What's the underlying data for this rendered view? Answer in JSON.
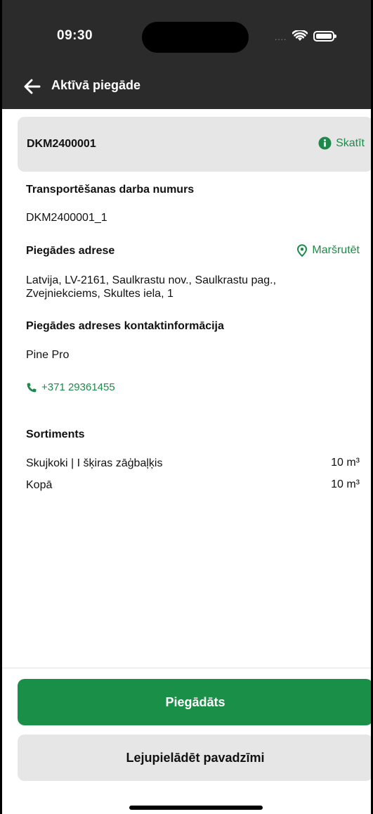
{
  "status_bar": {
    "time": "09:30",
    "signal": "....",
    "icons": [
      "wifi-icon",
      "battery-icon"
    ]
  },
  "nav": {
    "title": "Aktīvā piegāde",
    "back_icon": "arrow-left-icon"
  },
  "summary_card": {
    "id": "DKM2400001",
    "view_label": "Skatīt",
    "view_icon": "info-icon"
  },
  "details": {
    "job_number_label": "Transportēšanas darba numurs",
    "job_number_value": "DKM2400001_1",
    "address_label": "Piegādes adrese",
    "route_label": "Maršrutēt",
    "route_icon": "location-pin-icon",
    "address_line1": "Latvija, LV-2161, Saulkrastu nov., Saulkrastu pag.,",
    "address_line2": "Zvejniekciems, Skultes iela, 1",
    "contact_label": "Piegādes adreses kontaktinformācija",
    "contact_name": "Pine Pro",
    "phone": "+371 29361455",
    "phone_icon": "phone-icon"
  },
  "assortment": {
    "title": "Sortiments",
    "rows": [
      {
        "name": "Skujkoki | I šķiras zāģbaļķis",
        "amount": "10 m³"
      },
      {
        "name": "Kopā",
        "amount": "10 m³"
      }
    ]
  },
  "actions": {
    "delivered_label": "Piegādāts",
    "download_label": "Lejupielādēt pavadzīmi"
  },
  "colors": {
    "accent": "#1a8f47",
    "header_bg": "#2b2b2b",
    "card_bg": "#e6e6e6"
  }
}
